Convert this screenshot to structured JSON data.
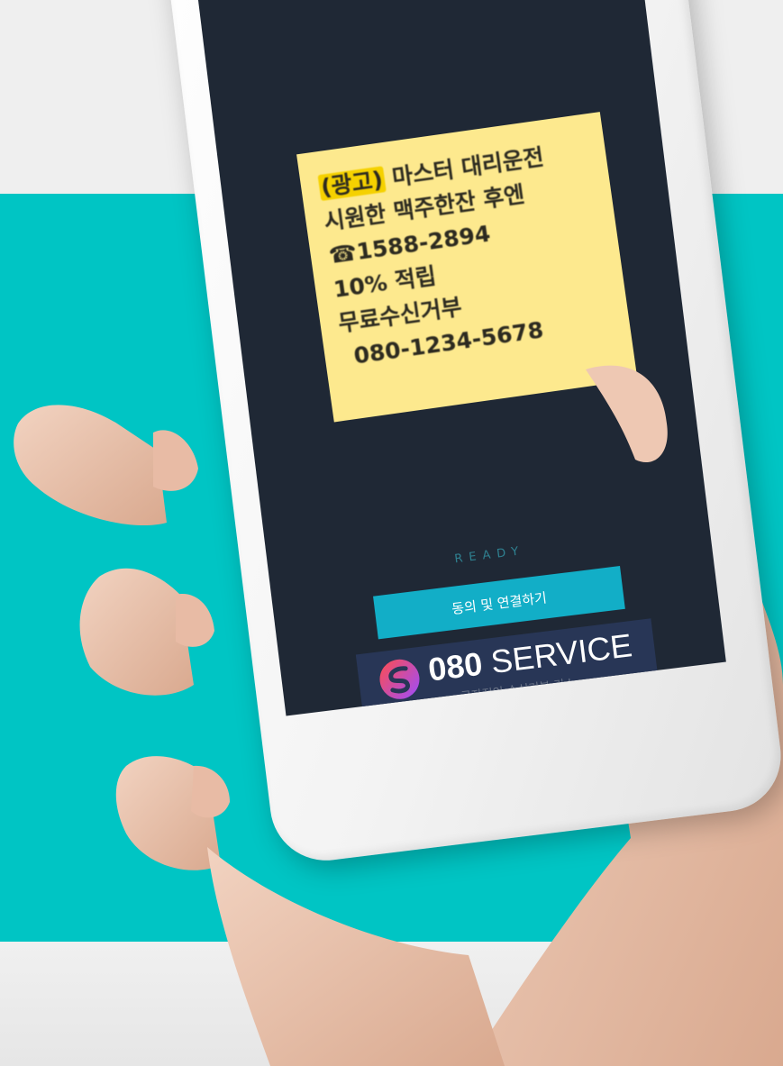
{
  "sms": {
    "lines": [
      {
        "tag": "(광고)",
        "text": " 마스터 대리운전"
      },
      {
        "text": "시원한 맥주한잔 후엔"
      },
      {
        "text": "☎1588-2894"
      },
      {
        "text": "10% 적립"
      },
      {
        "text": "무료수신거부"
      },
      {
        "text": "080-1234-5678"
      }
    ]
  },
  "status": "READY",
  "agree_button": "동의 및 연결하기",
  "service": {
    "brand_bold": "080",
    "brand_rest": " SERVICE",
    "subtitle": "국자적인 수신거부 리스",
    "logo_icon": "s-swirl-logo-icon"
  },
  "colors": {
    "band": "#00c5c4",
    "screen": "#1f2835",
    "sms_note": "#fde98e",
    "button": "#12aec7",
    "service_bar": "#283656"
  }
}
